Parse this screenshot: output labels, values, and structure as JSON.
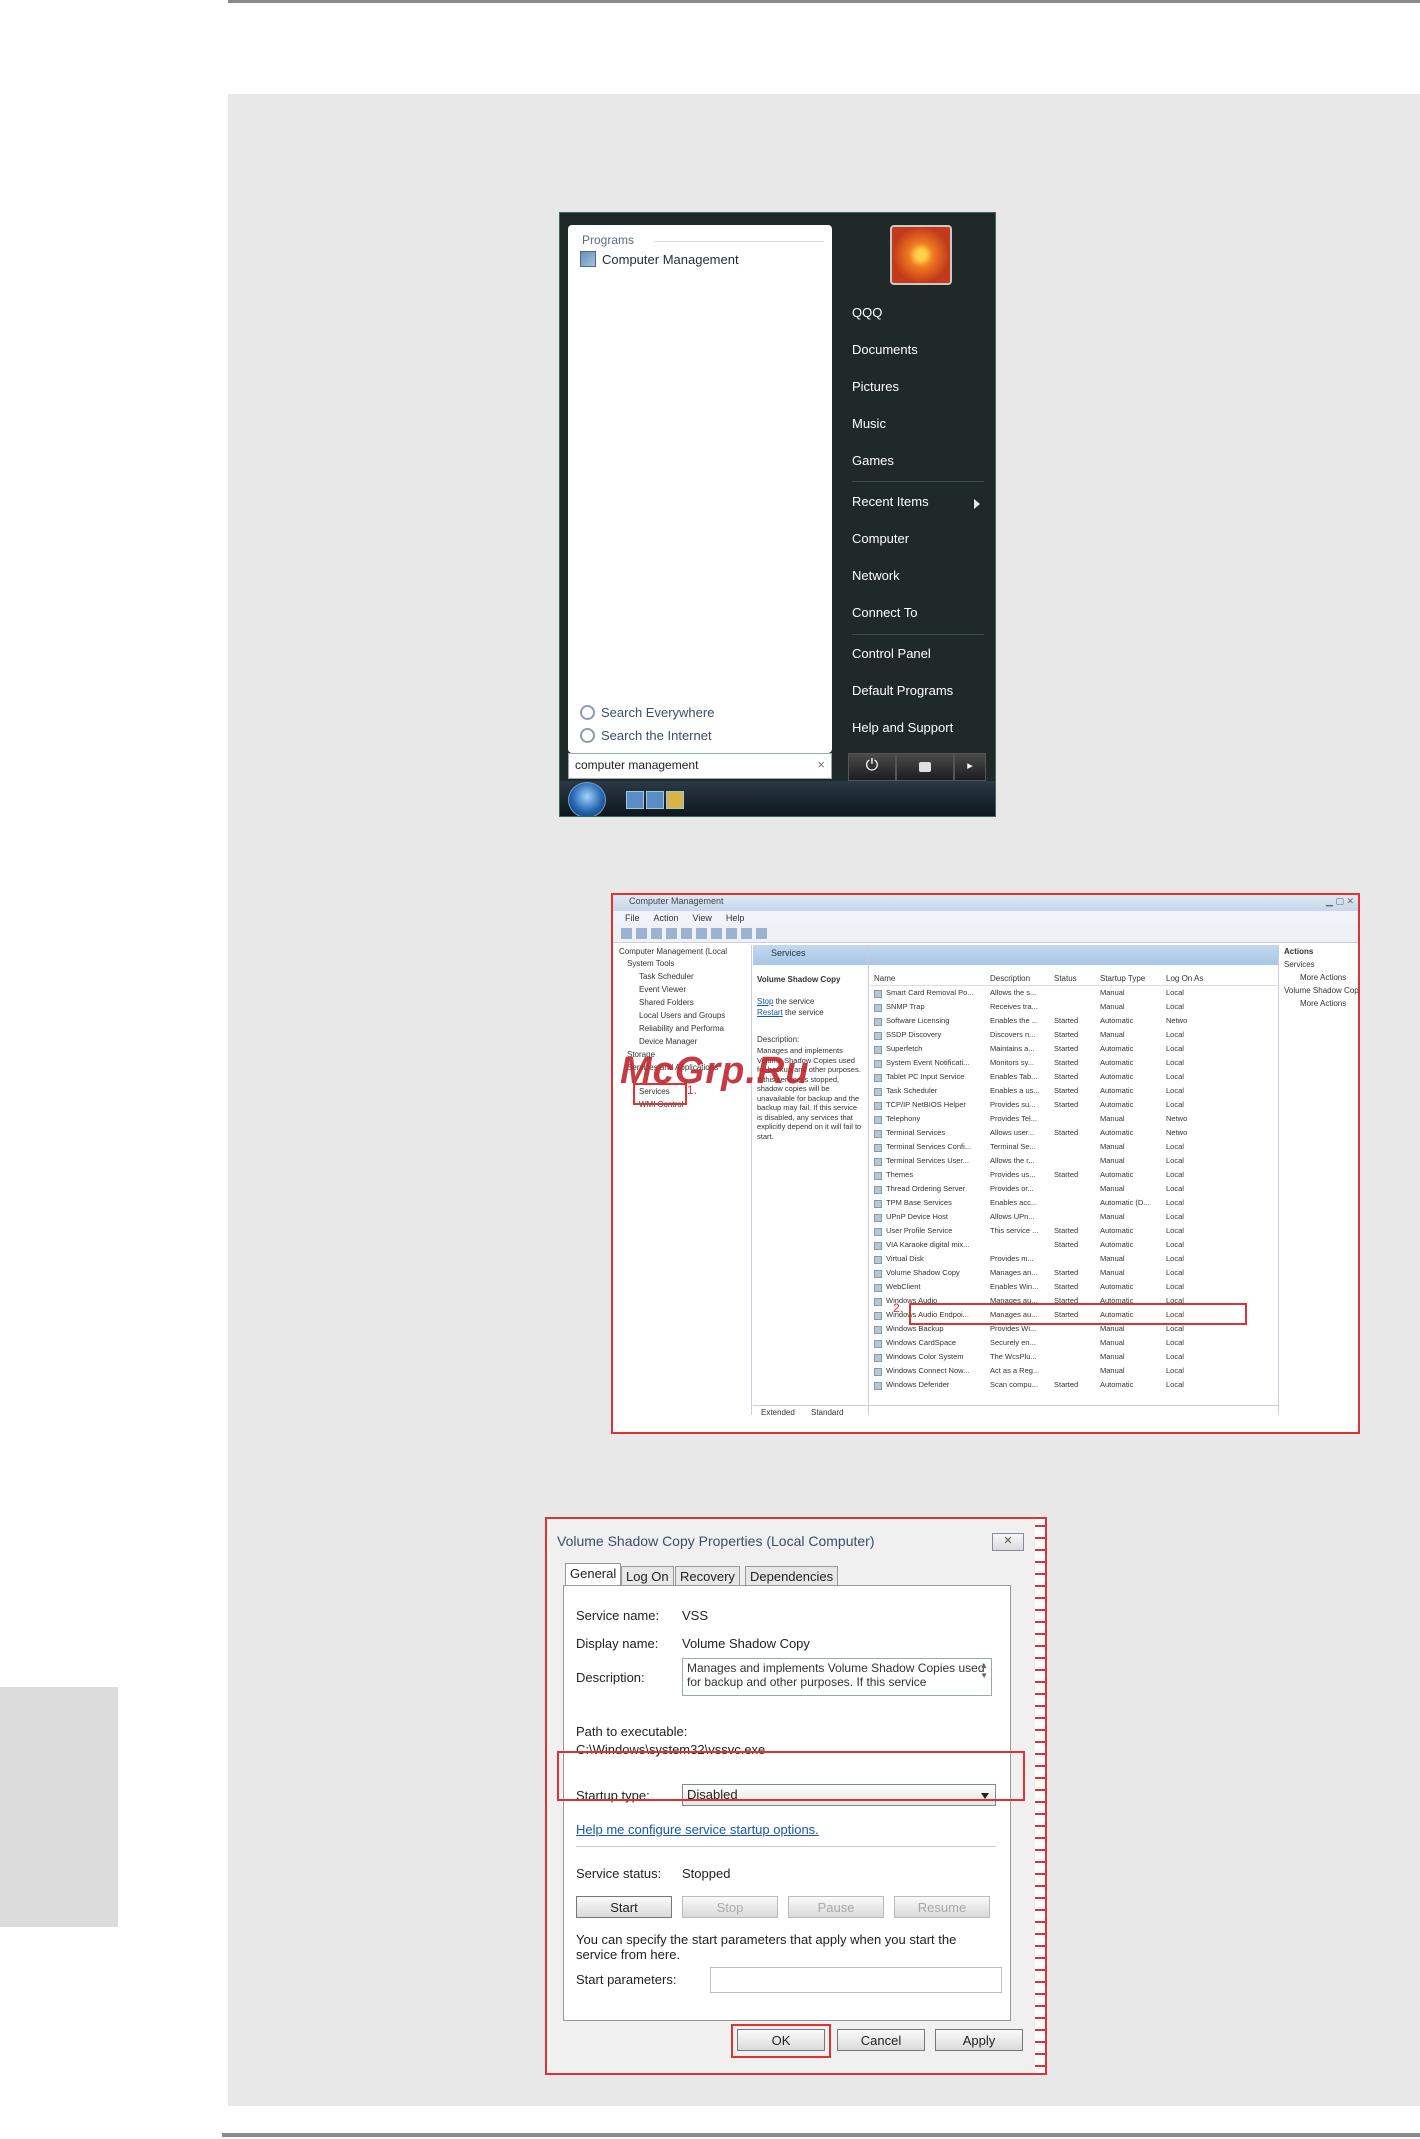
{
  "watermark": "McGrp.Ru",
  "start_menu": {
    "programs_heading": "Programs",
    "program_result": "Computer Management",
    "search_everywhere": "Search Everywhere",
    "search_internet": "Search the Internet",
    "search_value": "computer management",
    "right_items": [
      "QQQ",
      "Documents",
      "Pictures",
      "Music",
      "Games",
      "Recent Items",
      "Computer",
      "Network",
      "Connect To",
      "Control Panel",
      "Default Programs",
      "Help and Support"
    ]
  },
  "computer_management": {
    "title": "Computer Management",
    "menu": [
      "File",
      "Action",
      "View",
      "Help"
    ],
    "tree": [
      "Computer Management (Local",
      "System Tools",
      "Task Scheduler",
      "Event Viewer",
      "Shared Folders",
      "Local Users and Groups",
      "Reliability and Performa",
      "Device Manager",
      "Storage",
      "Services and Applications",
      "Services",
      "WMI Control"
    ],
    "header": "Services",
    "selected_service": "Volume Shadow Copy",
    "stop_link": "Stop",
    "stop_text": " the service",
    "restart_link": "Restart",
    "restart_text": " the service",
    "description_label": "Description:",
    "description_text": "Manages and implements Volume Shadow Copies used for backup and other purposes. If this service is stopped, shadow copies will be unavailable for backup and the backup may fail. If this service is disabled, any services that explicitly depend on it will fail to start.",
    "columns": [
      "Name",
      "Description",
      "Status",
      "Startup Type",
      "Log On As"
    ],
    "rows": [
      [
        "Smart Card Removal Po...",
        "Allows the s...",
        "",
        "Manual",
        "Local"
      ],
      [
        "SNMP Trap",
        "Receives tra...",
        "",
        "Manual",
        "Local"
      ],
      [
        "Software Licensing",
        "Enables the ...",
        "Started",
        "Automatic",
        "Netwo"
      ],
      [
        "SSDP Discovery",
        "Discovers n...",
        "Started",
        "Manual",
        "Local"
      ],
      [
        "Superfetch",
        "Maintains a...",
        "Started",
        "Automatic",
        "Local"
      ],
      [
        "System Event Notificati...",
        "Monitors sy...",
        "Started",
        "Automatic",
        "Local"
      ],
      [
        "Tablet PC Input Service",
        "Enables Tab...",
        "Started",
        "Automatic",
        "Local"
      ],
      [
        "Task Scheduler",
        "Enables a us...",
        "Started",
        "Automatic",
        "Local"
      ],
      [
        "TCP/IP NetBIOS Helper",
        "Provides su...",
        "Started",
        "Automatic",
        "Local"
      ],
      [
        "Telephony",
        "Provides Tel...",
        "",
        "Manual",
        "Netwo"
      ],
      [
        "Terminal Services",
        "Allows user...",
        "Started",
        "Automatic",
        "Netwo"
      ],
      [
        "Terminal Services Confi...",
        "Terminal Se...",
        "",
        "Manual",
        "Local"
      ],
      [
        "Terminal Services User...",
        "Allows the r...",
        "",
        "Manual",
        "Local"
      ],
      [
        "Themes",
        "Provides us...",
        "Started",
        "Automatic",
        "Local"
      ],
      [
        "Thread Ordering Server",
        "Provides or...",
        "",
        "Manual",
        "Local"
      ],
      [
        "TPM Base Services",
        "Enables acc...",
        "",
        "Automatic (D...",
        "Local"
      ],
      [
        "UPnP Device Host",
        "Allows UPn...",
        "",
        "Manual",
        "Local"
      ],
      [
        "User Profile Service",
        "This service ...",
        "Started",
        "Automatic",
        "Local"
      ],
      [
        "VIA Karaoke digital mix...",
        "",
        "Started",
        "Automatic",
        "Local"
      ],
      [
        "Virtual Disk",
        "Provides m...",
        "",
        "Manual",
        "Local"
      ],
      [
        "Volume Shadow Copy",
        "Manages an...",
        "Started",
        "Manual",
        "Local"
      ],
      [
        "WebClient",
        "Enables Win...",
        "Started",
        "Automatic",
        "Local"
      ],
      [
        "Windows Audio",
        "Manages au...",
        "Started",
        "Automatic",
        "Local"
      ],
      [
        "Windows Audio Endpoi...",
        "Manages au...",
        "Started",
        "Automatic",
        "Local"
      ],
      [
        "Windows Backup",
        "Provides Wi...",
        "",
        "Manual",
        "Local"
      ],
      [
        "Windows CardSpace",
        "Securely en...",
        "",
        "Manual",
        "Local"
      ],
      [
        "Windows Color System",
        "The WcsPlu...",
        "",
        "Manual",
        "Local"
      ],
      [
        "Windows Connect Now...",
        "Act as a Reg...",
        "",
        "Manual",
        "Local"
      ],
      [
        "Windows Defender",
        "Scan compu...",
        "Started",
        "Automatic",
        "Local"
      ]
    ],
    "actions_title": "Actions",
    "actions": [
      "Services",
      "More Actions",
      "Volume Shadow Copy",
      "More Actions"
    ],
    "bottom_tabs": [
      "Extended",
      "Standard"
    ],
    "marker_1": "1.",
    "marker_2": "2."
  },
  "dialog": {
    "title": "Volume Shadow Copy Properties (Local Computer)",
    "tabs": [
      "General",
      "Log On",
      "Recovery",
      "Dependencies"
    ],
    "service_name_label": "Service name:",
    "service_name": "VSS",
    "display_name_label": "Display name:",
    "display_name": "Volume Shadow Copy",
    "description_label": "Description:",
    "description": "Manages and implements Volume Shadow Copies used for backup and other purposes. If this service",
    "path_label": "Path to executable:",
    "path": "C:\\Windows\\system32\\vssvc.exe",
    "startup_label": "Startup type:",
    "startup_value": "Disabled",
    "help_link": "Help me configure service startup options.",
    "status_label": "Service status:",
    "status_value": "Stopped",
    "btn_start": "Start",
    "btn_stop": "Stop",
    "btn_pause": "Pause",
    "btn_resume": "Resume",
    "params_note": "You can specify the start parameters that apply when you start the service from here.",
    "params_label": "Start parameters:",
    "btn_ok": "OK",
    "btn_cancel": "Cancel",
    "btn_apply": "Apply"
  }
}
